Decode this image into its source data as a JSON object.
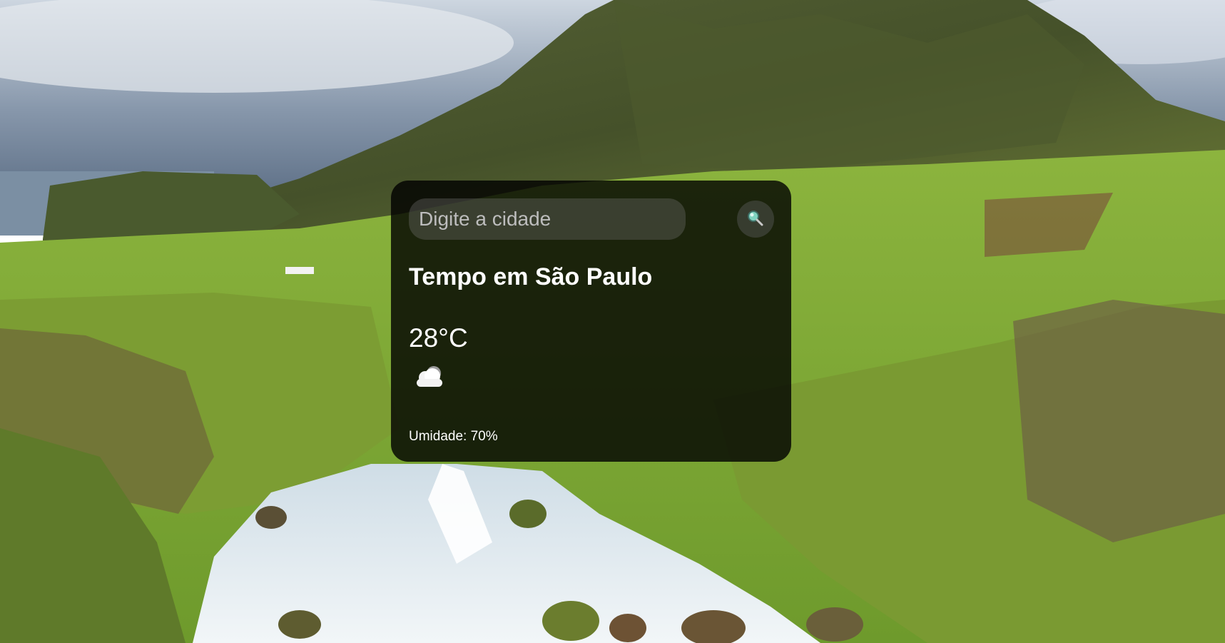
{
  "search": {
    "placeholder": "Digite a cidade",
    "value": "",
    "button_icon": "search-icon"
  },
  "weather": {
    "title": "Tempo em São Paulo",
    "temperature": "28°C",
    "condition_icon": "cloud-icon",
    "humidity": "Umidade: 70%"
  },
  "background": {
    "description_icon": "landscape-background",
    "colors": {
      "sky": "#9fb4c6",
      "grass": "#7fa83a",
      "mountain": "#4a5a2a",
      "water": "#dfe9ef"
    }
  }
}
